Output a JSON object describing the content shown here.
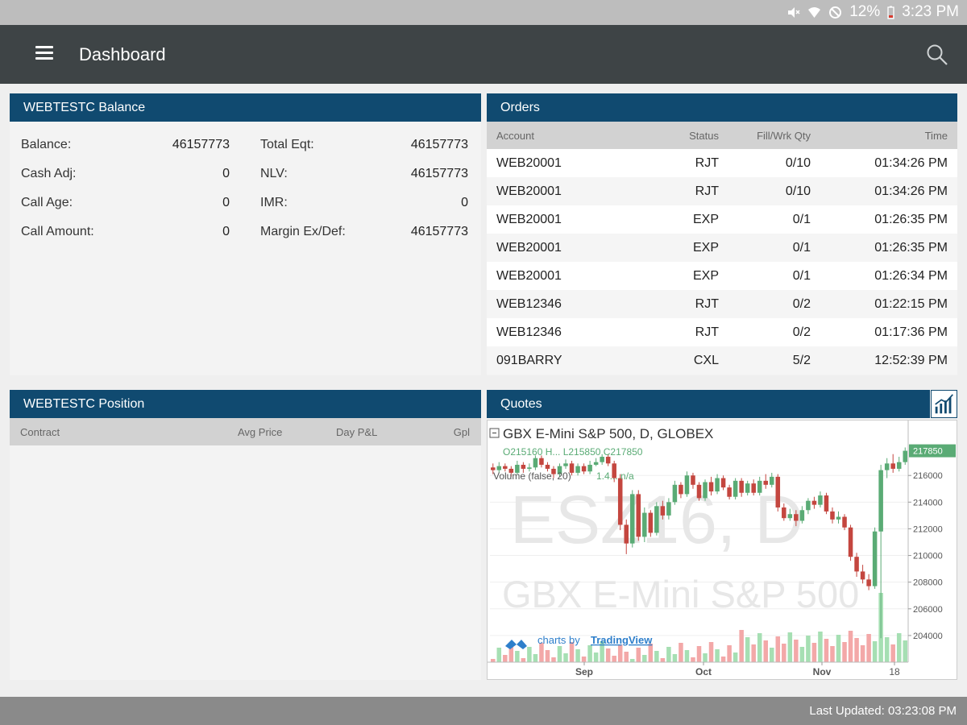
{
  "status_bar": {
    "battery": "12%",
    "time": "3:23 PM",
    "icons": [
      "mute-icon",
      "wifi-icon",
      "do-not-disturb-icon",
      "battery-icon"
    ]
  },
  "app_bar": {
    "title": "Dashboard",
    "menu_icon": "hamburger-icon",
    "search_icon": "search-icon"
  },
  "balance": {
    "title": "WEBTESTC Balance",
    "left": [
      {
        "label": "Balance:",
        "value": "46157773"
      },
      {
        "label": "Cash Adj:",
        "value": "0"
      },
      {
        "label": "Call Age:",
        "value": "0"
      },
      {
        "label": "Call Amount:",
        "value": "0"
      }
    ],
    "right": [
      {
        "label": "Total Eqt:",
        "value": "46157773"
      },
      {
        "label": "NLV:",
        "value": "46157773"
      },
      {
        "label": "IMR:",
        "value": "0"
      },
      {
        "label": "Margin Ex/Def:",
        "value": "46157773"
      }
    ]
  },
  "orders": {
    "title": "Orders",
    "columns": {
      "account": "Account",
      "status": "Status",
      "qty": "Fill/Wrk Qty",
      "time": "Time"
    },
    "rows": [
      {
        "account": "WEB20001",
        "status": "RJT",
        "qty": "0/10",
        "time": "01:34:26 PM"
      },
      {
        "account": "WEB20001",
        "status": "RJT",
        "qty": "0/10",
        "time": "01:34:26 PM"
      },
      {
        "account": "WEB20001",
        "status": "EXP",
        "qty": "0/1",
        "time": "01:26:35 PM"
      },
      {
        "account": "WEB20001",
        "status": "EXP",
        "qty": "0/1",
        "time": "01:26:35 PM"
      },
      {
        "account": "WEB20001",
        "status": "EXP",
        "qty": "0/1",
        "time": "01:26:34 PM"
      },
      {
        "account": "WEB12346",
        "status": "RJT",
        "qty": "0/2",
        "time": "01:22:15 PM"
      },
      {
        "account": "WEB12346",
        "status": "RJT",
        "qty": "0/2",
        "time": "01:17:36 PM"
      },
      {
        "account": "091BARRY",
        "status": "CXL",
        "qty": "5/2",
        "time": "12:52:39 PM"
      }
    ]
  },
  "position": {
    "title": "WEBTESTC Position",
    "columns": {
      "contract": "Contract",
      "avg_price": "Avg Price",
      "day_pl": "Day P&L",
      "gpl": "Gpl"
    }
  },
  "quotes": {
    "title": "Quotes",
    "toggle_icon": "chart-icon",
    "chart": {
      "symbol_title": "GBX E-Mini S&P 500, D, GLOBEX",
      "ohlc_text": "O215160 H... L215850 C217850",
      "volume_text": "Volume (false, 20)",
      "volume_value": "1.4... n/a",
      "watermark_big": "ESZ16, D",
      "watermark_small": "GBX E-Mini S&P 500",
      "last_price": "217850",
      "attribution_prefix": "charts by",
      "attribution_link": "TradingView",
      "colors": {
        "up": "#5aab75",
        "down": "#c4463f",
        "vol_up": "#a6dfb3",
        "vol_down": "#f3a8a8",
        "last_price": "#5aab75"
      }
    }
  },
  "chart_data": {
    "type": "candlestick",
    "title": "GBX E-Mini S&P 500, D, GLOBEX",
    "x_ticks": [
      "Sep",
      "Oct",
      "Nov",
      "18"
    ],
    "y_ticks": [
      204000,
      206000,
      208000,
      210000,
      212000,
      214000,
      216000
    ],
    "ylim": [
      202000,
      220000
    ],
    "last_price": 217850,
    "candles": [
      [
        216600,
        216400,
        216900,
        216100
      ],
      [
        216400,
        216700,
        217000,
        216200
      ],
      [
        216700,
        216500,
        216900,
        216300
      ],
      [
        216500,
        216200,
        216700,
        215900
      ],
      [
        216200,
        216800,
        217100,
        216100
      ],
      [
        216800,
        216500,
        217000,
        216200
      ],
      [
        216500,
        216600,
        216900,
        216300
      ],
      [
        216600,
        217300,
        217500,
        216400
      ],
      [
        217300,
        216800,
        217500,
        216600
      ],
      [
        216800,
        216500,
        217000,
        216300
      ],
      [
        216500,
        216100,
        216700,
        215800
      ],
      [
        216100,
        216700,
        216900,
        215900
      ],
      [
        216700,
        216900,
        217200,
        216500
      ],
      [
        216900,
        216200,
        217100,
        216000
      ],
      [
        216200,
        216700,
        216900,
        216000
      ],
      [
        216700,
        216300,
        216900,
        216100
      ],
      [
        216300,
        216800,
        217100,
        216100
      ],
      [
        216800,
        217000,
        217300,
        216700
      ],
      [
        217000,
        217400,
        217600,
        216800
      ],
      [
        217400,
        216900,
        217600,
        216700
      ],
      [
        216900,
        215800,
        217100,
        215500
      ],
      [
        215800,
        212300,
        216100,
        211900
      ],
      [
        212300,
        210900,
        212700,
        210100
      ],
      [
        210900,
        214600,
        214900,
        210600
      ],
      [
        214600,
        211400,
        214900,
        211100
      ],
      [
        211400,
        213200,
        213600,
        211000
      ],
      [
        213200,
        211700,
        213400,
        211400
      ],
      [
        211700,
        213700,
        214000,
        211500
      ],
      [
        213700,
        213000,
        214100,
        212700
      ],
      [
        213000,
        214000,
        214300,
        212700
      ],
      [
        214000,
        215300,
        215600,
        213800
      ],
      [
        215300,
        214600,
        215500,
        214300
      ],
      [
        214600,
        216000,
        216300,
        214400
      ],
      [
        216000,
        215300,
        216200,
        215000
      ],
      [
        215300,
        214300,
        215500,
        214100
      ],
      [
        214300,
        215500,
        215700,
        214100
      ],
      [
        215500,
        214800,
        215900,
        214500
      ],
      [
        214800,
        215800,
        216100,
        214600
      ],
      [
        215800,
        215100,
        216000,
        214900
      ],
      [
        215100,
        214400,
        215300,
        214200
      ],
      [
        214400,
        215600,
        215800,
        214200
      ],
      [
        215600,
        214700,
        215800,
        214400
      ],
      [
        214700,
        215400,
        215600,
        214500
      ],
      [
        215400,
        214700,
        215700,
        214500
      ],
      [
        214700,
        215600,
        215900,
        214500
      ],
      [
        215600,
        215300,
        216100,
        215000
      ],
      [
        215300,
        215900,
        216200,
        215100
      ],
      [
        215900,
        213600,
        216100,
        213300
      ],
      [
        213600,
        212800,
        213900,
        212600
      ],
      [
        212800,
        213100,
        213500,
        212600
      ],
      [
        213100,
        212600,
        213400,
        212200
      ],
      [
        212600,
        213400,
        213700,
        212400
      ],
      [
        213400,
        214100,
        214300,
        213100
      ],
      [
        214100,
        213800,
        214400,
        213500
      ],
      [
        213800,
        214500,
        214800,
        213600
      ],
      [
        214500,
        213300,
        214700,
        213100
      ],
      [
        213300,
        212700,
        213600,
        212400
      ],
      [
        212700,
        212900,
        213300,
        212400
      ],
      [
        212900,
        212100,
        213100,
        211900
      ],
      [
        212100,
        209900,
        212300,
        209600
      ],
      [
        209900,
        208800,
        210200,
        208400
      ],
      [
        208800,
        208200,
        209300,
        207900
      ],
      [
        208200,
        207700,
        208600,
        207400
      ],
      [
        207700,
        211800,
        212100,
        207500
      ],
      [
        211800,
        216400,
        216800,
        203800
      ],
      [
        216400,
        216900,
        217300,
        215800
      ],
      [
        216900,
        216500,
        217600,
        216200
      ],
      [
        216500,
        217000,
        217400,
        216300
      ],
      [
        217000,
        217850,
        218100,
        216800
      ]
    ],
    "volumes": [
      0,
      0,
      0,
      0,
      0,
      0,
      0,
      0,
      0,
      0,
      0,
      0,
      0,
      0,
      0,
      0,
      0,
      0,
      0,
      0,
      0,
      0,
      0,
      0,
      0,
      0,
      0,
      0,
      0,
      0,
      0,
      0,
      0,
      0,
      0,
      0,
      0,
      0,
      0,
      0,
      0,
      0,
      0,
      0,
      0,
      0,
      0,
      0,
      0,
      0,
      0,
      0,
      0,
      0,
      0,
      0,
      0,
      0,
      0,
      0,
      0,
      0,
      0,
      0,
      0,
      0,
      0,
      0,
      0
    ]
  },
  "footer": {
    "last_updated": "Last Updated: 03:23:08 PM"
  }
}
